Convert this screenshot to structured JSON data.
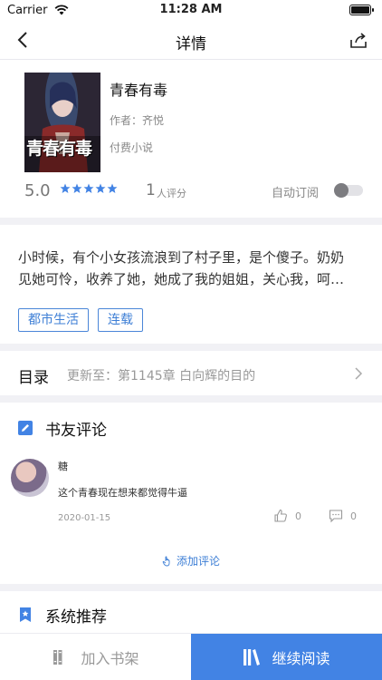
{
  "status_bar": {
    "carrier": "Carrier",
    "time": "11:28 AM"
  },
  "nav": {
    "title": "详情",
    "back_icon": "chevron-left-icon",
    "share_icon": "share-icon"
  },
  "book": {
    "cover_text": "青春有毒",
    "title": "青春有毒",
    "author_label": "作者：",
    "author": "齐悦",
    "type": "付费小说",
    "score": "5.0",
    "stars": 5,
    "rating_count": "1",
    "rating_unit": "人评分",
    "auto_subscribe_label": "自动订阅",
    "auto_subscribe_on": false
  },
  "intro": {
    "line1": "小时候，有个小女孩流浪到了村子里，是个傻子。奶奶",
    "line2": "见她可怜，收养了她，她成了我的姐姐，关心我，呵…"
  },
  "tags": [
    "都市生活",
    "连载"
  ],
  "toc": {
    "title": "目录",
    "latest": "更新至：第1145章 白向辉的目的"
  },
  "comments_section": {
    "title": "书友评论",
    "items": [
      {
        "user": "糖",
        "text": "这个青春现在想来都觉得牛逼",
        "date": "2020-01-15",
        "likes": "0",
        "replies": "0"
      }
    ],
    "add_label": "添加评论"
  },
  "recommend": {
    "title": "系统推荐"
  },
  "bottom_bar": {
    "shelf_label": "加入书架",
    "read_label": "继续阅读"
  },
  "colors": {
    "accent": "#4283e4",
    "tag": "#3e7fd6",
    "separator": "#f1f1f5"
  }
}
